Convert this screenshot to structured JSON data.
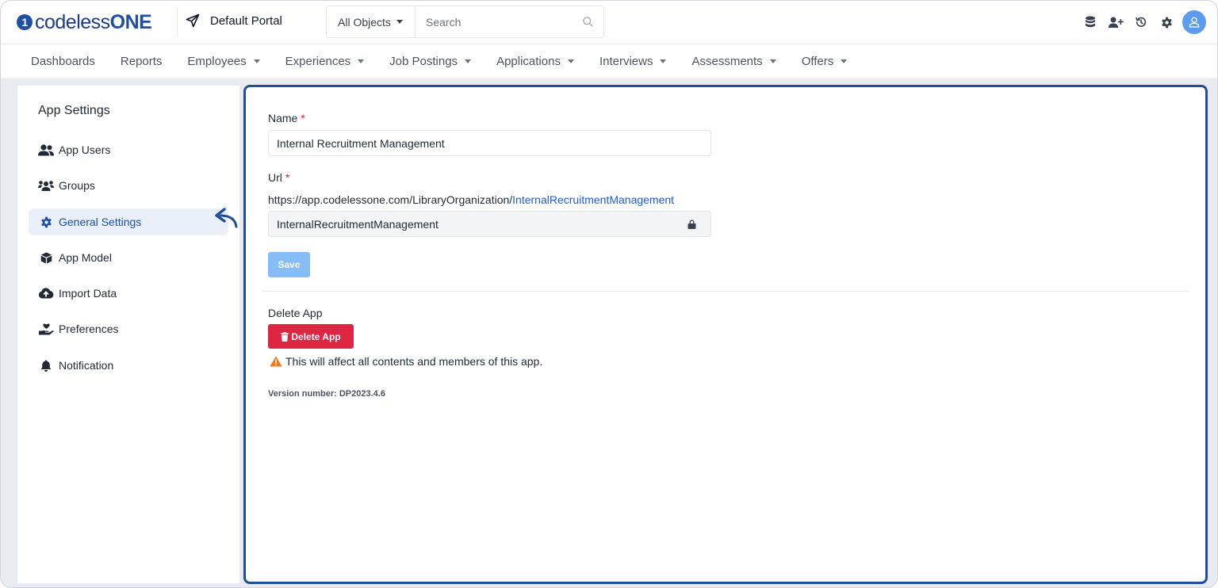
{
  "header": {
    "logo_text": "codeless",
    "logo_one": "ONE",
    "logo_mark": "1",
    "portal_name": "Default Portal",
    "search_scope": "All Objects",
    "search_placeholder": "Search",
    "icons": [
      "database-icon",
      "add-user-icon",
      "history-icon",
      "gear-icon",
      "user-avatar-icon"
    ]
  },
  "nav": {
    "items": [
      {
        "label": "Dashboards",
        "dropdown": false
      },
      {
        "label": "Reports",
        "dropdown": false
      },
      {
        "label": "Employees",
        "dropdown": true
      },
      {
        "label": "Experiences",
        "dropdown": true
      },
      {
        "label": "Job Postings",
        "dropdown": true
      },
      {
        "label": "Applications",
        "dropdown": true
      },
      {
        "label": "Interviews",
        "dropdown": true
      },
      {
        "label": "Assessments",
        "dropdown": true
      },
      {
        "label": "Offers",
        "dropdown": true
      }
    ]
  },
  "sidebar": {
    "title": "App Settings",
    "items": [
      {
        "label": "App Users",
        "icon": "users-icon"
      },
      {
        "label": "Groups",
        "icon": "group-icon"
      },
      {
        "label": "General Settings",
        "icon": "gear-icon",
        "active": true
      },
      {
        "label": "App Model",
        "icon": "cube-icon"
      },
      {
        "label": "Import Data",
        "icon": "cloud-upload-icon"
      },
      {
        "label": "Preferences",
        "icon": "hand-heart-icon"
      },
      {
        "label": "Notification",
        "icon": "bell-icon"
      }
    ]
  },
  "form": {
    "name_label": "Name",
    "required_mark": "*",
    "name_value": "Internal Recruitment Management",
    "url_label": "Url",
    "url_base": "https://app.codelessone.com/LibraryOrganization/",
    "url_slug": "InternalRecruitmentManagement",
    "url_field_value": "InternalRecruitmentManagement",
    "save_label": "Save",
    "delete_section_label": "Delete App",
    "delete_button_label": "Delete App",
    "warning_text": "This will affect all contents and members of this app.",
    "version_text": "Version number: DP2023.4.6"
  },
  "colors": {
    "brand": "#1e4fa3",
    "active_bg": "#e9f0f9",
    "danger": "#dc2642",
    "save_disabled": "#86bdf6",
    "warning": "#f97316",
    "link": "#1e5bd8"
  }
}
